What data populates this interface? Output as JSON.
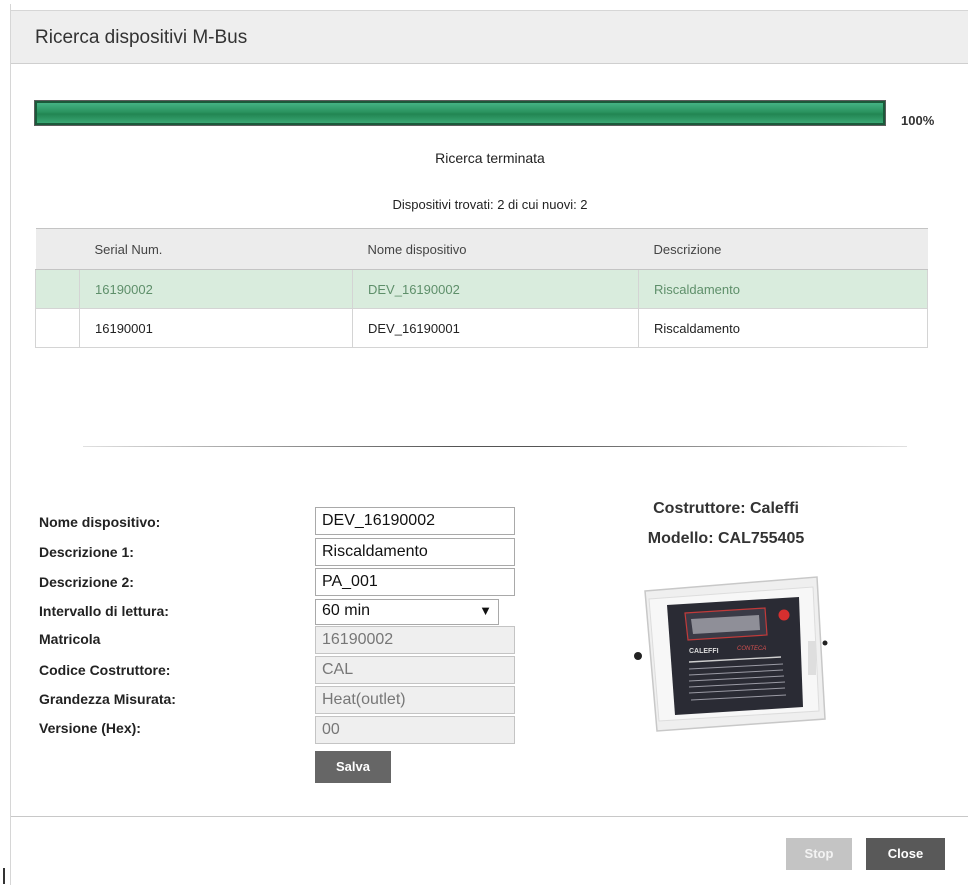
{
  "dialog": {
    "title": "Ricerca dispositivi M-Bus"
  },
  "progress": {
    "percent_value": 100,
    "percent_label": "100%",
    "color": "#2a935f"
  },
  "status": {
    "message": "Ricerca terminata",
    "found": "Dispositivi trovati: 2 di cui nuovi: 2"
  },
  "table": {
    "columns": [
      "Serial Num.",
      "Nome dispositivo",
      "Descrizione"
    ],
    "rows": [
      {
        "serial": "16190002",
        "name": "DEV_16190002",
        "description": "Riscaldamento",
        "selected": true
      },
      {
        "serial": "16190001",
        "name": "DEV_16190001",
        "description": "Riscaldamento",
        "selected": false
      }
    ]
  },
  "form": {
    "labels": {
      "name": "Nome dispositivo:",
      "desc1": "Descrizione 1:",
      "desc2": "Descrizione 2:",
      "interval": "Intervallo di lettura:",
      "serial": "Matricola",
      "manufacturer_code": "Codice Costruttore:",
      "quantity": "Grandezza Misurata:",
      "version": "Versione (Hex):"
    },
    "values": {
      "name": "DEV_16190002",
      "desc1": "Riscaldamento",
      "desc2": "PA_001",
      "interval": "60 min",
      "serial": "16190002",
      "manufacturer_code": "CAL",
      "quantity": "Heat(outlet)",
      "version": "00"
    },
    "save_label": "Salva"
  },
  "device": {
    "manufacturer": "Costruttore: Caleffi",
    "model": "Modello: CAL755405",
    "image_icon": "heat-meter-device",
    "brand_text": "CALEFFI",
    "product_text": "CONTECA"
  },
  "footer": {
    "stop_label": "Stop",
    "close_label": "Close"
  }
}
